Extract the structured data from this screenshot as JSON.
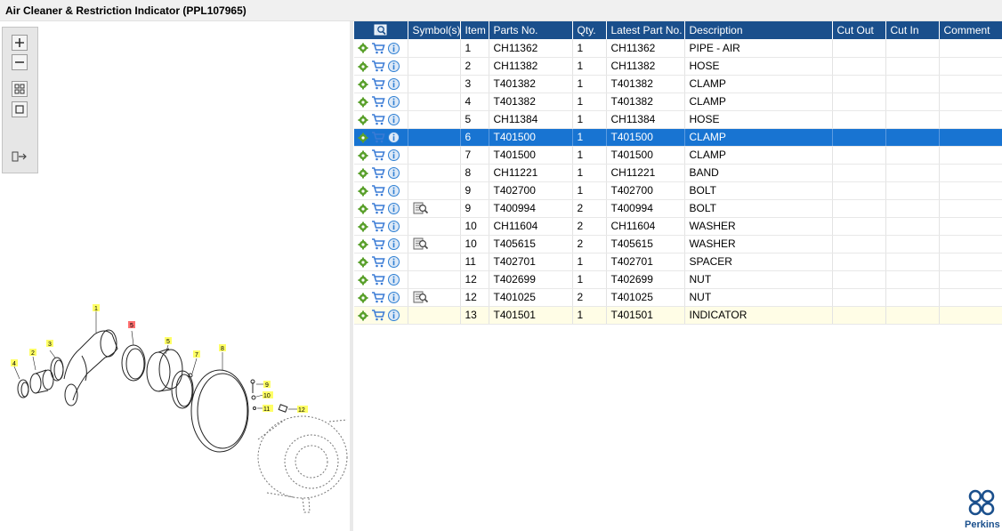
{
  "window": {
    "title": "Air Cleaner & Restriction Indicator (PPL107965)"
  },
  "toolbox": {
    "buttons": [
      "zoom-in",
      "zoom-out",
      "fit-all",
      "fit-page",
      "export"
    ]
  },
  "drawing": {
    "callouts": [
      "1",
      "2",
      "3",
      "4",
      "5",
      "5",
      "7",
      "8",
      "9",
      "10",
      "11",
      "12"
    ]
  },
  "grid": {
    "columns": [
      "",
      "Symbol(s)",
      "Item",
      "Parts No.",
      "Qty.",
      "Latest Part No.",
      "Description",
      "Cut Out",
      "Cut In",
      "Comment"
    ],
    "rows": [
      {
        "symbol": false,
        "item": "1",
        "part": "CH11362",
        "qty": "1",
        "latest": "CH11362",
        "desc": "PIPE - AIR"
      },
      {
        "symbol": false,
        "item": "2",
        "part": "CH11382",
        "qty": "1",
        "latest": "CH11382",
        "desc": "HOSE"
      },
      {
        "symbol": false,
        "item": "3",
        "part": "T401382",
        "qty": "1",
        "latest": "T401382",
        "desc": "CLAMP"
      },
      {
        "symbol": false,
        "item": "4",
        "part": "T401382",
        "qty": "1",
        "latest": "T401382",
        "desc": "CLAMP"
      },
      {
        "symbol": false,
        "item": "5",
        "part": "CH11384",
        "qty": "1",
        "latest": "CH11384",
        "desc": "HOSE"
      },
      {
        "symbol": false,
        "item": "6",
        "part": "T401500",
        "qty": "1",
        "latest": "T401500",
        "desc": "CLAMP"
      },
      {
        "symbol": false,
        "item": "7",
        "part": "T401500",
        "qty": "1",
        "latest": "T401500",
        "desc": "CLAMP"
      },
      {
        "symbol": false,
        "item": "8",
        "part": "CH11221",
        "qty": "1",
        "latest": "CH11221",
        "desc": "BAND"
      },
      {
        "symbol": false,
        "item": "9",
        "part": "T402700",
        "qty": "1",
        "latest": "T402700",
        "desc": "BOLT"
      },
      {
        "symbol": true,
        "item": "9",
        "part": "T400994",
        "qty": "2",
        "latest": "T400994",
        "desc": "BOLT"
      },
      {
        "symbol": false,
        "item": "10",
        "part": "CH11604",
        "qty": "2",
        "latest": "CH11604",
        "desc": "WASHER"
      },
      {
        "symbol": true,
        "item": "10",
        "part": "T405615",
        "qty": "2",
        "latest": "T405615",
        "desc": "WASHER"
      },
      {
        "symbol": false,
        "item": "11",
        "part": "T402701",
        "qty": "1",
        "latest": "T402701",
        "desc": "SPACER"
      },
      {
        "symbol": false,
        "item": "12",
        "part": "T402699",
        "qty": "1",
        "latest": "T402699",
        "desc": "NUT"
      },
      {
        "symbol": true,
        "item": "12",
        "part": "T401025",
        "qty": "2",
        "latest": "T401025",
        "desc": "NUT"
      },
      {
        "symbol": false,
        "item": "13",
        "part": "T401501",
        "qty": "1",
        "latest": "T401501",
        "desc": "INDICATOR"
      }
    ],
    "selected_row": 5,
    "highlight_row": 15
  },
  "brand": {
    "name": "Perkins",
    "color": "#1a4f8c"
  },
  "colors": {
    "header": "#1a4f8c",
    "selected": "#1874d2",
    "gear": "#5aa02c",
    "cart": "#3a7bd5",
    "info": "#2d7fd3"
  }
}
